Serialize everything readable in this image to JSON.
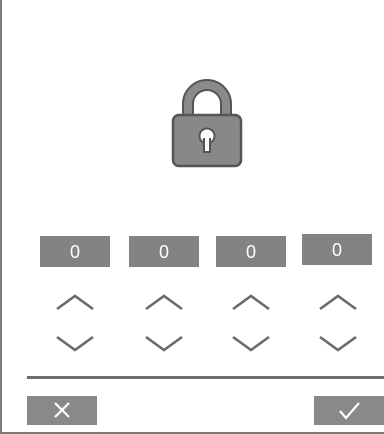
{
  "pin": {
    "digits": [
      "0",
      "0",
      "0",
      "0"
    ]
  },
  "icons": {
    "lock": "lock-icon",
    "increment": "chevron-up-icon",
    "decrement": "chevron-down-icon",
    "cancel": "close-icon",
    "confirm": "check-icon"
  },
  "colors": {
    "box_fill": "#838383",
    "lock_fill": "#888888",
    "lock_stroke": "#555555",
    "chevron": "#6a6a6a",
    "divider": "#6e6e6e",
    "button_fill": "#898989"
  }
}
